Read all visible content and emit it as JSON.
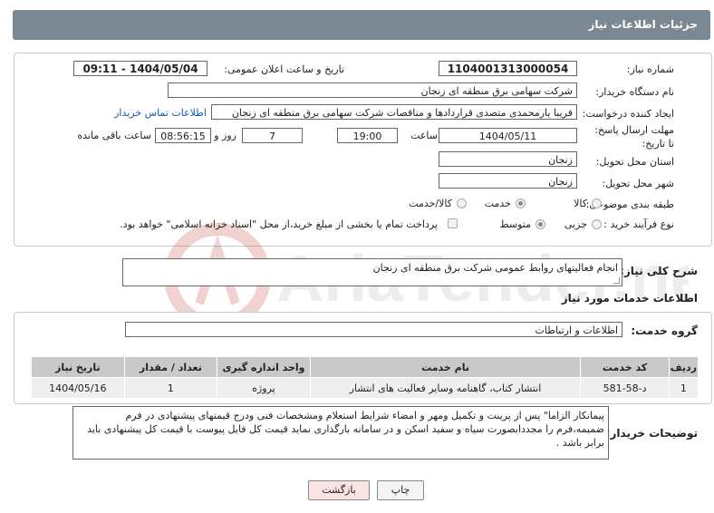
{
  "header": {
    "title": "جزئیات اطلاعات نیاز"
  },
  "form": {
    "need_number_label": "شماره نیاز:",
    "need_number": "1104001313000054",
    "announce_label": "تاریخ و ساعت اعلان عمومی:",
    "announce_value": "1404/05/04 - 09:11",
    "buyer_org_label": "نام دستگاه خریدار:",
    "buyer_org": "شرکت سهامی برق منطقه ای زنجان",
    "creator_label": "ایجاد کننده درخواست:",
    "creator": "فریبا یارمحمدی متصدی قراردادها و مناقصات شرکت سهامی برق منطقه ای زنجان",
    "contact_link": "اطلاعات تماس خریدار",
    "deadline_label": "مهلت ارسال پاسخ: تا تاریخ:",
    "deadline_date": "1404/05/11",
    "time_label": "ساعت",
    "deadline_time": "19:00",
    "days_value": "7",
    "days_label": "روز و",
    "remaining_time": "08:56:15",
    "remaining_label": "ساعت باقی مانده",
    "province_label": "استان محل تحویل:",
    "province": "زنجان",
    "city_label": "شهر محل تحویل:",
    "city": "زنجان",
    "category_label": "طبقه بندی موضوعی:",
    "category_options": [
      "کالا",
      "خدمت",
      "کالا/خدمت"
    ],
    "category_selected": "خدمت",
    "process_label": "نوع فرآیند خرید :",
    "process_options": [
      "جزیی",
      "متوسط"
    ],
    "process_selected": "جزیی",
    "payment_note": "پرداخت تمام یا بخشی از مبلغ خرید،از محل \"اسناد خزانه اسلامی\" خواهد بود."
  },
  "summary": {
    "label": "شرح کلی نیاز:",
    "value": "انجام فعالیتهای روابط عمومی شرکت برق منطقه ای زنجان"
  },
  "services": {
    "section_title": "اطلاعات خدمات مورد نیاز",
    "group_label": "گروه خدمت:",
    "group_value": "اطلاعات و ارتباطات",
    "columns": [
      "ردیف",
      "کد خدمت",
      "نام خدمت",
      "واحد اندازه گیری",
      "تعداد / مقدار",
      "تاریخ نیاز"
    ],
    "rows": [
      [
        "1",
        "د-58-581",
        "انتشار کتاب، گاهنامه وسایر فعالیت های انتشار",
        "پروژه",
        "1",
        "1404/05/16"
      ]
    ]
  },
  "notes": {
    "label": "توضیحات خریدار:",
    "text": "پیمانکار الزاما\" پس از پرینت و تکمیل ومهر و امضاء شرایط استعلام ومشخصات فنی ودرج قیمتهای پیشنهادی در فرم ضمیمه،فرم را مجددابصورت سیاه و سفید اسکن و در سامانه بارگذاری نماید قیمت کل فایل پیوست با قیمت کل پیشنهادی باید برابر باشد ."
  },
  "buttons": {
    "print": "چاپ",
    "back": "بازگشت"
  },
  "colors": {
    "titlebar": "#7a8893",
    "back_button_bg": "#fbe3e3",
    "link": "#1a5aa8",
    "watermark": "#c0392b"
  },
  "watermark_text": "AriaTender.neT"
}
